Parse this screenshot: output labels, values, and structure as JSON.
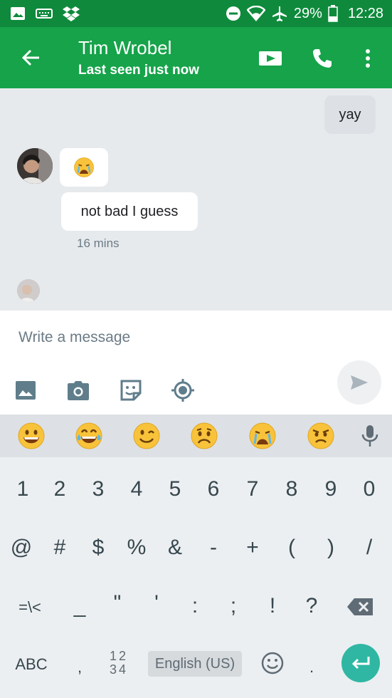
{
  "status_bar": {
    "battery": "29%",
    "time": "12:28"
  },
  "header": {
    "contact_name": "Tim Wrobel",
    "last_seen": "Last seen just now"
  },
  "messages": {
    "outgoing_text": "yay",
    "incoming_text": "not bad I guess",
    "timestamp": "16 mins"
  },
  "composer": {
    "placeholder": "Write a message"
  },
  "keyboard": {
    "row1": [
      "1",
      "2",
      "3",
      "4",
      "5",
      "6",
      "7",
      "8",
      "9",
      "0"
    ],
    "row2": [
      "@",
      "#",
      "$",
      "%",
      "&",
      "-",
      "+",
      "(",
      ")",
      "/"
    ],
    "row3": [
      "=\\<",
      "_",
      "\"",
      "'",
      ":",
      ";",
      "!",
      "?"
    ],
    "abc_label": "ABC",
    "comma": ",",
    "numbers_top": "12",
    "numbers_bottom": "34",
    "language_label": "English (US)",
    "period": "."
  },
  "colors": {
    "app_bar": "#16a34a",
    "status_bar": "#0f8a3c",
    "enter_key": "#2fb7a3"
  }
}
